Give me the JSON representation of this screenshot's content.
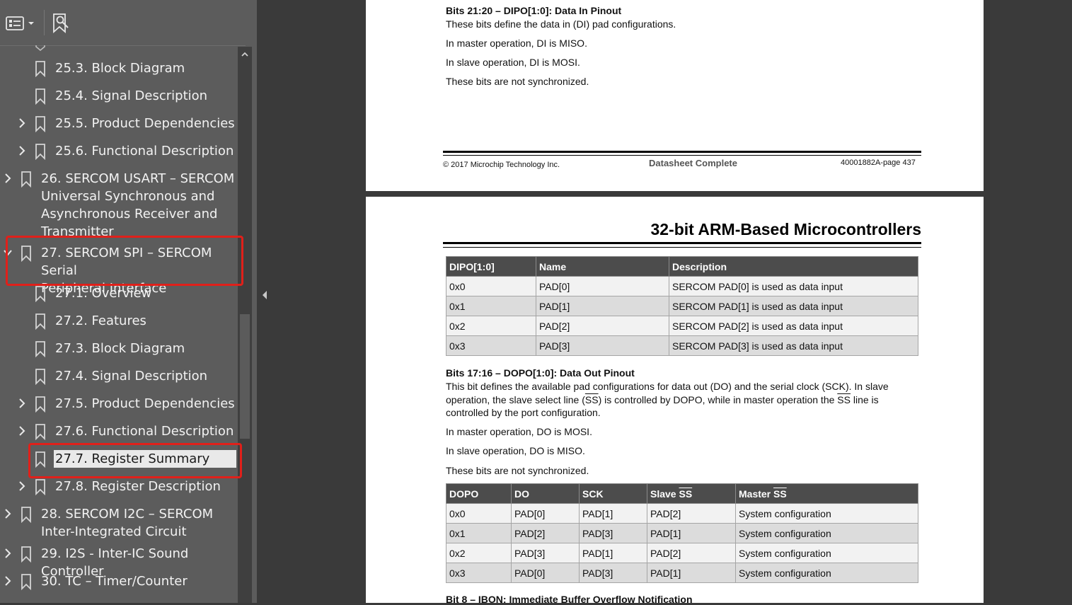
{
  "sidebar": {
    "toolbar": {
      "outline_icon": "outline-list-icon",
      "dropdown_icon": "chevron-down-icon",
      "find_icon": "bookmark-search-icon"
    },
    "items": [
      {
        "label": "25.3. Block Diagram",
        "level": 2,
        "expandable": false
      },
      {
        "label": "25.4. Signal Description",
        "level": 2,
        "expandable": false
      },
      {
        "label": "25.5. Product Dependencies",
        "level": 2,
        "expandable": true
      },
      {
        "label": "25.6. Functional Description",
        "level": 2,
        "expandable": true
      },
      {
        "label": "26. SERCOM USART – SERCOM\nUniversal Synchronous and\nAsynchronous Receiver and\nTransmitter",
        "level": 1,
        "expandable": true
      },
      {
        "label": "27. SERCOM SPI – SERCOM Serial\nPeripheral Interface",
        "level": 1,
        "expandable": true,
        "expanded": true
      },
      {
        "label": "27.1. Overview",
        "level": 2,
        "expandable": false
      },
      {
        "label": "27.2. Features",
        "level": 2,
        "expandable": false
      },
      {
        "label": "27.3. Block Diagram",
        "level": 2,
        "expandable": false
      },
      {
        "label": "27.4. Signal Description",
        "level": 2,
        "expandable": false
      },
      {
        "label": "27.5. Product Dependencies",
        "level": 2,
        "expandable": true
      },
      {
        "label": "27.6. Functional Description",
        "level": 2,
        "expandable": true
      },
      {
        "label": "27.7. Register Summary",
        "level": 2,
        "expandable": false,
        "selected": true
      },
      {
        "label": "27.8. Register Description",
        "level": 2,
        "expandable": true
      },
      {
        "label": "28. SERCOM I2C – SERCOM\nInter-Integrated Circuit",
        "level": 1,
        "expandable": true
      },
      {
        "label": "29. I2S - Inter-IC Sound Controller",
        "level": 1,
        "expandable": true
      },
      {
        "label": "30. TC – Timer/Counter",
        "level": 1,
        "expandable": true
      }
    ]
  },
  "page1": {
    "section_heading": "Bits 21:20 – DIPO[1:0]:  Data In Pinout",
    "lines": [
      "These bits define the data in (DI) pad configurations.",
      "In master operation, DI is MISO.",
      "In slave operation, DI is MOSI.",
      "These bits are not synchronized."
    ],
    "footer": {
      "copyright": "© 2017 Microchip Technology Inc.",
      "center": "Datasheet Complete",
      "page": "40001882A-page 437"
    }
  },
  "page2": {
    "header_title": "32-bit ARM-Based Microcontrollers",
    "dipo_table": {
      "headers": [
        "DIPO[1:0]",
        "Name",
        "Description"
      ],
      "rows": [
        [
          "0x0",
          "PAD[0]",
          "SERCOM PAD[0] is used as data input"
        ],
        [
          "0x1",
          "PAD[1]",
          "SERCOM PAD[1] is used as data input"
        ],
        [
          "0x2",
          "PAD[2]",
          "SERCOM PAD[2] is used as data input"
        ],
        [
          "0x3",
          "PAD[3]",
          "SERCOM PAD[3] is used as data input"
        ]
      ]
    },
    "dopo_heading": "Bits 17:16 – DOPO[1:0]:  Data Out Pinout",
    "dopo_para": {
      "line1": "This bit defines the available pad configurations for data out (DO) and the serial clock (SCK). In slave",
      "line2_a": "operation, the slave select line (",
      "line2_ss": "SS",
      "line2_b": ") is controlled by DOPO, while in master operation the ",
      "line2_ss2": "SS",
      "line2_c": " line is",
      "line3": "controlled by the port configuration."
    },
    "dopo_lines": [
      "In master operation, DO is MOSI.",
      "In slave operation, DO is MISO.",
      "These bits are not synchronized."
    ],
    "dopo_table": {
      "headers": [
        "DOPO",
        "DO",
        "SCK",
        "Slave ",
        "Master "
      ],
      "ss": "SS",
      "rows": [
        [
          "0x0",
          "PAD[0]",
          "PAD[1]",
          "PAD[2]",
          "System configuration"
        ],
        [
          "0x1",
          "PAD[2]",
          "PAD[3]",
          "PAD[1]",
          "System configuration"
        ],
        [
          "0x2",
          "PAD[3]",
          "PAD[1]",
          "PAD[2]",
          "System configuration"
        ],
        [
          "0x3",
          "PAD[0]",
          "PAD[3]",
          "PAD[1]",
          "System configuration"
        ]
      ]
    },
    "next_heading": "Bit 8 – IBON:  Immediate Buffer Overflow Notification"
  }
}
